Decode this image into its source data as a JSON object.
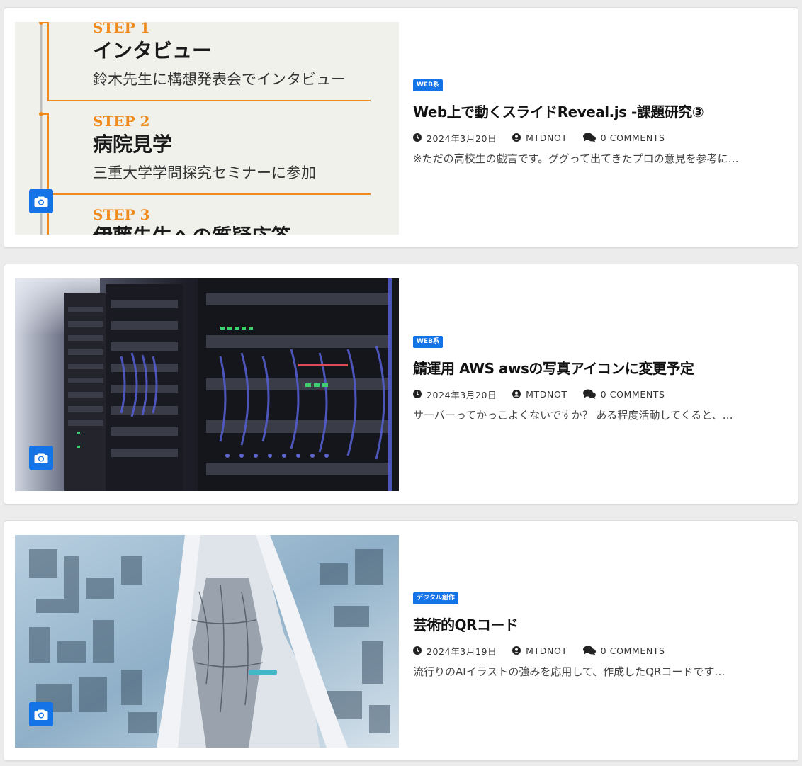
{
  "colors": {
    "accent": "#1473e6",
    "step_orange": "#f08a1c"
  },
  "posts": [
    {
      "category": "WEB系",
      "title": "Web上で動くスライドReveal.js -課題研究③",
      "date": "2024年3月20日",
      "author": "MTDNOT",
      "comments": "0 COMMENTS",
      "excerpt": "※ただの高校生の戯言です。ググって出てきたプロの意見を参考に…",
      "image": {
        "kind": "steps-slide",
        "steps": [
          {
            "label": "STEP 1",
            "title": "インタビュー",
            "desc": "鈴木先生に構想発表会でインタビュー"
          },
          {
            "label": "STEP 2",
            "title": "病院見学",
            "desc": "三重大学学問探究セミナーに参加"
          },
          {
            "label": "STEP 3",
            "title": "伊藤先生への質疑応答",
            "desc": ""
          }
        ]
      }
    },
    {
      "category": "WEB系",
      "title": "鯖運用 AWS awsの写真アイコンに変更予定",
      "date": "2024年3月20日",
      "author": "MTDNOT",
      "comments": "0 COMMENTS",
      "excerpt": "サーバーってかっこよくないですか？ ある程度活動してくると、…",
      "image": {
        "kind": "server-racks-photo"
      }
    },
    {
      "category": "デジタル創作",
      "title": "芸術的QRコード",
      "date": "2024年3月19日",
      "author": "MTDNOT",
      "comments": "0 COMMENTS",
      "excerpt": "流行りのAIイラストの強みを応用して、作成したQRコードです…",
      "image": {
        "kind": "ai-illustration-qr"
      }
    }
  ],
  "icons": {
    "camera": "camera-icon",
    "clock": "clock-icon",
    "author": "user-circle-icon",
    "comments": "comments-icon"
  }
}
